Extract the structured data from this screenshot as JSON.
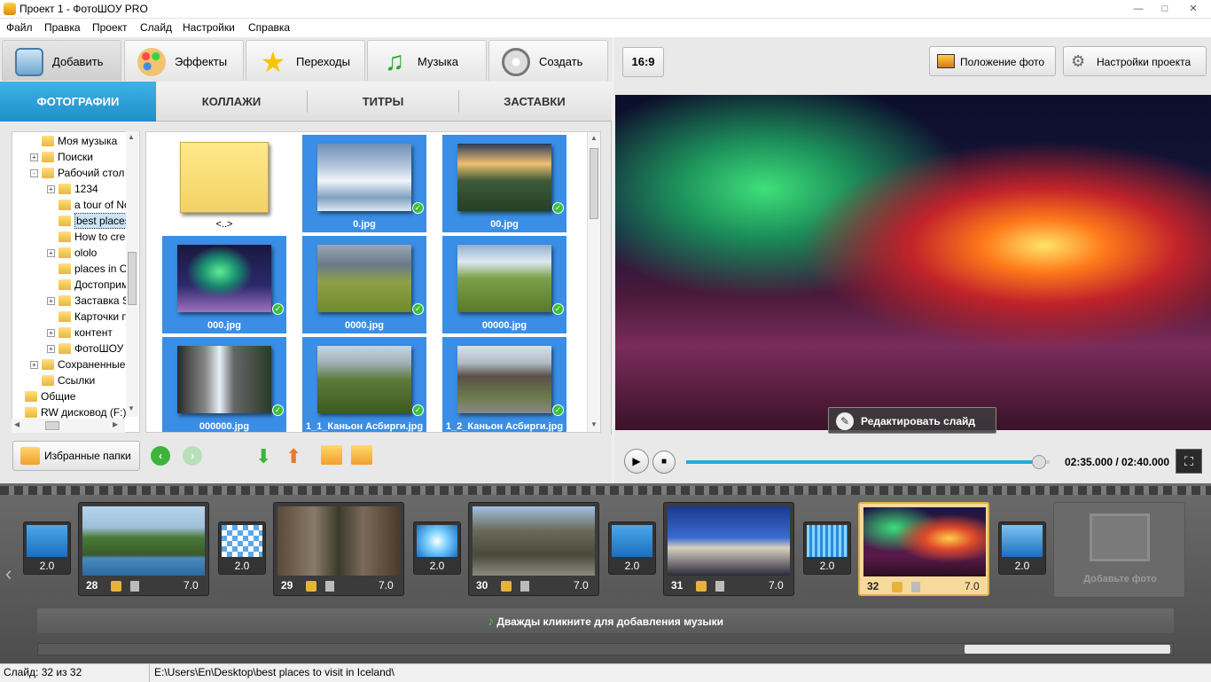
{
  "window": {
    "title": "Проект 1 - ФотоШОУ PRO"
  },
  "menu": [
    "Файл",
    "Правка",
    "Проект",
    "Слайд",
    "Настройки",
    "Справка"
  ],
  "main_tabs": [
    {
      "label": "Добавить",
      "icon": "camera-icon"
    },
    {
      "label": "Эффекты",
      "icon": "palette-icon"
    },
    {
      "label": "Переходы",
      "icon": "star-icon"
    },
    {
      "label": "Музыка",
      "icon": "music-note-icon"
    },
    {
      "label": "Создать",
      "icon": "film-reel-icon"
    }
  ],
  "sub_tabs": [
    "ФОТОГРАФИИ",
    "КОЛЛАЖИ",
    "ТИТРЫ",
    "ЗАСТАВКИ"
  ],
  "tree": [
    {
      "label": "Моя музыка",
      "indent": 1,
      "expander": "",
      "selected": false
    },
    {
      "label": "Поиски",
      "indent": 1,
      "expander": "+",
      "selected": false
    },
    {
      "label": "Рабочий стол",
      "indent": 1,
      "expander": "-",
      "selected": false
    },
    {
      "label": "1234",
      "indent": 2,
      "expander": "+",
      "selected": false
    },
    {
      "label": "a tour of Nor",
      "indent": 2,
      "expander": "",
      "selected": false
    },
    {
      "label": "best places t",
      "indent": 2,
      "expander": "",
      "selected": true
    },
    {
      "label": "How to creat",
      "indent": 2,
      "expander": "",
      "selected": false
    },
    {
      "label": "ololo",
      "indent": 2,
      "expander": "+",
      "selected": false
    },
    {
      "label": "places in Chi",
      "indent": 2,
      "expander": "",
      "selected": false
    },
    {
      "label": "Достоприме",
      "indent": 2,
      "expander": "",
      "selected": false
    },
    {
      "label": "Заставка Sn",
      "indent": 2,
      "expander": "+",
      "selected": false
    },
    {
      "label": "Карточки пр",
      "indent": 2,
      "expander": "",
      "selected": false
    },
    {
      "label": "контент",
      "indent": 2,
      "expander": "+",
      "selected": false
    },
    {
      "label": "ФотоШОУ Cl",
      "indent": 2,
      "expander": "+",
      "selected": false
    },
    {
      "label": "Сохраненные и",
      "indent": 1,
      "expander": "+",
      "selected": false
    },
    {
      "label": "Ссылки",
      "indent": 1,
      "expander": "",
      "selected": false
    },
    {
      "label": "Общие",
      "indent": 0,
      "expander": "",
      "selected": false
    },
    {
      "label": "RW дисковод (F:)",
      "indent": 0,
      "expander": "",
      "selected": false
    }
  ],
  "files": [
    {
      "name": "<..>",
      "type": "parent-folder",
      "selected": false
    },
    {
      "name": "0.jpg",
      "type": "image",
      "selected": true
    },
    {
      "name": "00.jpg",
      "type": "image",
      "selected": true
    },
    {
      "name": "000.jpg",
      "type": "image",
      "selected": true
    },
    {
      "name": "0000.jpg",
      "type": "image",
      "selected": true
    },
    {
      "name": "00000.jpg",
      "type": "image",
      "selected": true
    },
    {
      "name": "000000.jpg",
      "type": "image",
      "selected": true
    },
    {
      "name": "1_1_Каньон Асбирги.jpg",
      "type": "image",
      "selected": true
    },
    {
      "name": "1_2_Каньон Асбирги.jpg",
      "type": "image",
      "selected": true
    }
  ],
  "left_bottom": {
    "favorites_label": "Избранные папки"
  },
  "right": {
    "aspect_label": "16:9",
    "photo_pos_label": "Положение фото",
    "settings_label": "Настройки проекта",
    "edit_slide_label": "Редактировать слайд",
    "time_display": "02:35.000 / 02:40.000",
    "progress": 0.97
  },
  "timeline": {
    "slides": [
      {
        "num": "28",
        "dur": "7.0",
        "selected": false
      },
      {
        "num": "29",
        "dur": "7.0",
        "selected": false
      },
      {
        "num": "30",
        "dur": "7.0",
        "selected": false
      },
      {
        "num": "31",
        "dur": "7.0",
        "selected": false
      },
      {
        "num": "32",
        "dur": "7.0",
        "selected": true
      }
    ],
    "transitions": [
      "2.0",
      "2.0",
      "2.0",
      "2.0",
      "2.0",
      "2.0"
    ],
    "add_photo_label": "Добавьте фото",
    "music_label": "Дважды кликните для добавления музыки"
  },
  "status": {
    "slide": "Слайд: 32 из 32",
    "path": "E:\\Users\\En\\Desktop\\best places to visit in Iceland\\"
  }
}
